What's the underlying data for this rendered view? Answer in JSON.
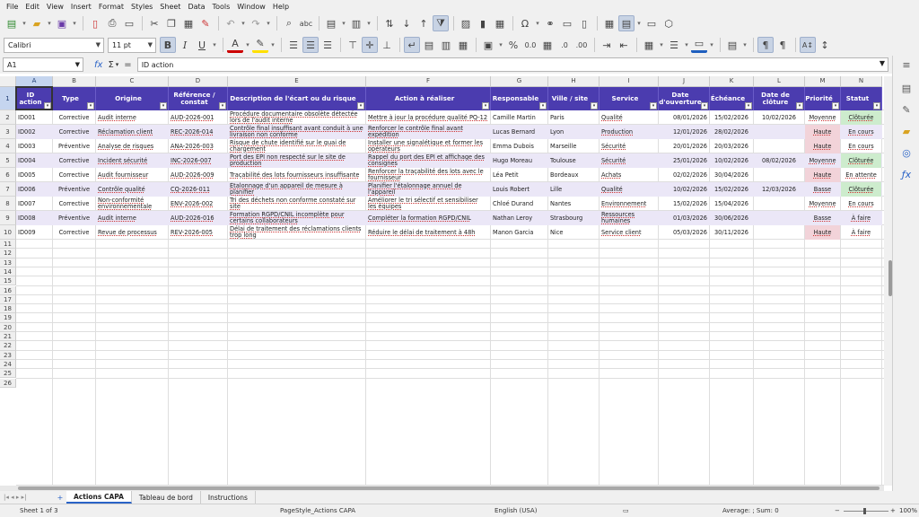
{
  "menu": [
    "File",
    "Edit",
    "View",
    "Insert",
    "Format",
    "Styles",
    "Sheet",
    "Data",
    "Tools",
    "Window",
    "Help"
  ],
  "font": {
    "name": "Calibri",
    "size": "11 pt"
  },
  "formula_bar": {
    "cell_ref": "A1",
    "content": "ID action",
    "fx": "fx",
    "sigma": "Σ",
    "eq": "="
  },
  "columns": [
    "A",
    "B",
    "C",
    "D",
    "E",
    "F",
    "G",
    "H",
    "I",
    "J",
    "K",
    "L",
    "M",
    "N"
  ],
  "headers": [
    "ID action",
    "Type",
    "Origine",
    "Référence / constat",
    "Description de l'écart ou du risque",
    "Action à réaliser",
    "Responsable",
    "Ville / site",
    "Service",
    "Date d'ouverture",
    "Échéance",
    "Date de clôture",
    "Priorité",
    "Statut"
  ],
  "rows": [
    [
      "ID001",
      "Corrective",
      "Audit interne",
      "AUD-2026-001",
      "Procédure documentaire obsolète détectée lors de l'audit interne",
      "Mettre à jour la procédure qualité PQ-12",
      "Camille Martin",
      "Paris",
      "Qualité",
      "08/01/2026",
      "15/02/2026",
      "10/02/2026",
      "Moyenne",
      "Clôturée"
    ],
    [
      "ID002",
      "Corrective",
      "Réclamation client",
      "REC-2026-014",
      "Contrôle final insuffisant avant conduit à une livraison non conforme",
      "Renforcer le contrôle final avant expédition",
      "Lucas Bernard",
      "Lyon",
      "Production",
      "12/01/2026",
      "28/02/2026",
      "",
      "Haute",
      "En cours"
    ],
    [
      "ID003",
      "Préventive",
      "Analyse de risques",
      "ANA-2026-003",
      "Risque de chute identifié sur le quai de chargement",
      "Installer une signalétique et former les opérateurs",
      "Emma Dubois",
      "Marseille",
      "Sécurité",
      "20/01/2026",
      "20/03/2026",
      "",
      "Haute",
      "En cours"
    ],
    [
      "ID004",
      "Corrective",
      "Incident sécurité",
      "INC-2026-007",
      "Port des EPI non respecté sur le site de production",
      "Rappel du port des EPI et affichage des consignes",
      "Hugo Moreau",
      "Toulouse",
      "Sécurité",
      "25/01/2026",
      "10/02/2026",
      "08/02/2026",
      "Moyenne",
      "Clôturée"
    ],
    [
      "ID005",
      "Corrective",
      "Audit fournisseur",
      "AUD-2026-009",
      "Traçabilité des lots fournisseurs insuffisante",
      "Renforcer la traçabilité des lots avec le fournisseur",
      "Léa Petit",
      "Bordeaux",
      "Achats",
      "02/02/2026",
      "30/04/2026",
      "",
      "Haute",
      "En attente"
    ],
    [
      "ID006",
      "Préventive",
      "Contrôle qualité",
      "CQ-2026-011",
      "Étalonnage d'un appareil de mesure à planifier",
      "Planifier l'étalonnage annuel de l'appareil",
      "Louis Robert",
      "Lille",
      "Qualité",
      "10/02/2026",
      "15/02/2026",
      "12/03/2026",
      "Basse",
      "Clôturée"
    ],
    [
      "ID007",
      "Corrective",
      "Non-conformité environnementale",
      "ENV-2026-002",
      "Tri des déchets non conforme constaté sur site",
      "Améliorer le tri sélectif et sensibiliser les équipes",
      "Chloé Durand",
      "Nantes",
      "Environnement",
      "15/02/2026",
      "15/04/2026",
      "",
      "Moyenne",
      "En cours"
    ],
    [
      "ID008",
      "Préventive",
      "Audit interne",
      "AUD-2026-016",
      "Formation RGPD/CNIL incomplète pour certains collaborateurs",
      "Compléter la formation RGPD/CNIL",
      "Nathan Leroy",
      "Strasbourg",
      "Ressources humaines",
      "01/03/2026",
      "30/06/2026",
      "",
      "Basse",
      "À faire"
    ],
    [
      "ID009",
      "Corrective",
      "Revue de processus",
      "REV-2026-005",
      "Délai de traitement des réclamations clients trop long",
      "Réduire le délai de traitement à 48h",
      "Manon Garcia",
      "Nice",
      "Service client",
      "05/03/2026",
      "30/11/2026",
      "",
      "Haute",
      "À faire"
    ]
  ],
  "row_numbers": [
    "1",
    "2",
    "3",
    "4",
    "5",
    "6",
    "7",
    "8",
    "9",
    "10",
    "11",
    "12",
    "13",
    "14",
    "15",
    "16",
    "17",
    "18",
    "19",
    "20",
    "21",
    "22",
    "23",
    "24",
    "25",
    "26"
  ],
  "sheet_tabs": [
    "Actions CAPA",
    "Tableau de bord",
    "Instructions"
  ],
  "active_sheet": "Actions CAPA",
  "tab_add": "+",
  "status": {
    "sheet": "Sheet 1 of 3",
    "page_style": "PageStyle_Actions CAPA",
    "language": "English (USA)",
    "sum": "Average: ; Sum: 0",
    "zoom": "100%"
  },
  "colors": {
    "header_bg": "#4b3caf",
    "band_bg": "#ebe7f7",
    "priority_high": "#f2d3d9",
    "status_closed": "#cdeccd"
  }
}
